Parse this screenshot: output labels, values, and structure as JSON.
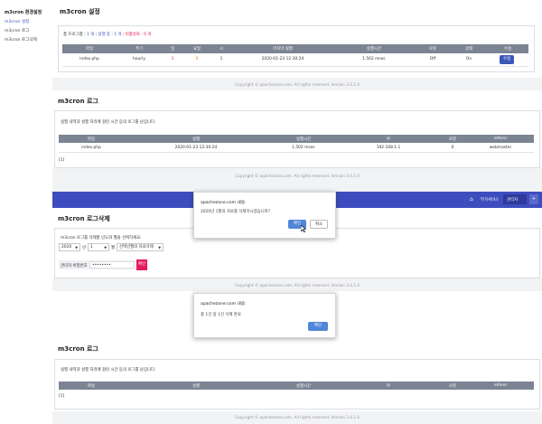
{
  "sidebar": {
    "title": "m3cron 환경설정",
    "items": [
      {
        "label": "m3cron 설정",
        "active": true
      },
      {
        "label": "m3cron 로그",
        "active": false
      },
      {
        "label": "m3cron 로그삭제",
        "active": false
      }
    ]
  },
  "settings": {
    "title": "m3cron 설정",
    "summary": {
      "prefix": "총 프로그램 :",
      "total": "1 개",
      "running": "실행 중 : 1 개",
      "stopped": "비활성화 : 0 개"
    },
    "columns": [
      "파일",
      "주기",
      "일",
      "요일",
      "시",
      "마지막 실행",
      "실행시간",
      "로봇",
      "상태",
      "수정"
    ],
    "row": {
      "file": "index.php",
      "cycle": "hourly",
      "day": "1",
      "weekday": "0",
      "hour": "1",
      "last_run": "2020-01-23 12:30:24",
      "exec_time": "1.502 msec",
      "robot": "Off",
      "state": "On",
      "edit": "수정"
    },
    "footer": "Copyright © apachezone.com. All rights reserved. Version 3.4.1.4"
  },
  "log1": {
    "title": "m3cron 로그",
    "desc": "실행 내역과 실행 처리에 걸린 시간 등의 로그를 남깁니다.",
    "columns": [
      "파일",
      "실행",
      "실행시간",
      "ip",
      "로봇",
      "referer"
    ],
    "row": {
      "file": "index.php",
      "run": "2020-01-23 12:30:24",
      "exec_time": "1.502 msec",
      "ip": "192.168.1.1",
      "robot": "0",
      "referer": "webmaster"
    },
    "pager": "[1]",
    "footer": "Copyright © apachezone.com. All rights reserved. Version 3.4.1.4"
  },
  "navbar": {
    "home_icon": "⌂",
    "links": [
      "부가서비스",
      "관리자"
    ],
    "plus": "+"
  },
  "logdel": {
    "title": "m3cron 로그삭제",
    "desc": "m3cron 로그를 삭제할 년도와 월을 선택하세요.",
    "year": "2020",
    "year_suffix": "년",
    "month": "1",
    "month_suffix": "월",
    "mode": "선택년월의 자료삭제",
    "pw_label": "관리자 비밀번호",
    "pw_value": "••••••••",
    "confirm": "확인",
    "footer": "Copyright © apachezone.com. All rights reserved. Version 3.4.1.4"
  },
  "dialog1": {
    "title": "apachezone.com 내용:",
    "message": "2020년 1월의 자료를 삭제하시겠습니까?",
    "ok": "확인",
    "cancel": "취소"
  },
  "dialog2": {
    "title": "apachezone.com 내용:",
    "message": "총 1건 중 1건 삭제 완료",
    "ok": "확인"
  },
  "log2": {
    "title": "m3cron 로그",
    "desc": "실행 내역과 실행 처리에 걸린 시간 등의 로그를 남깁니다.",
    "columns": [
      "파일",
      "실행",
      "실행시간",
      "ip",
      "로봇",
      "referer"
    ],
    "pager": "[1]",
    "footer": "Copyright © apachezone.com. All rights reserved. Version 3.4.1.4"
  },
  "colors": {
    "accent": "#3d57b8",
    "navbar": "#3e4dbe",
    "danger": "#e5195f",
    "header": "#7b8493"
  }
}
